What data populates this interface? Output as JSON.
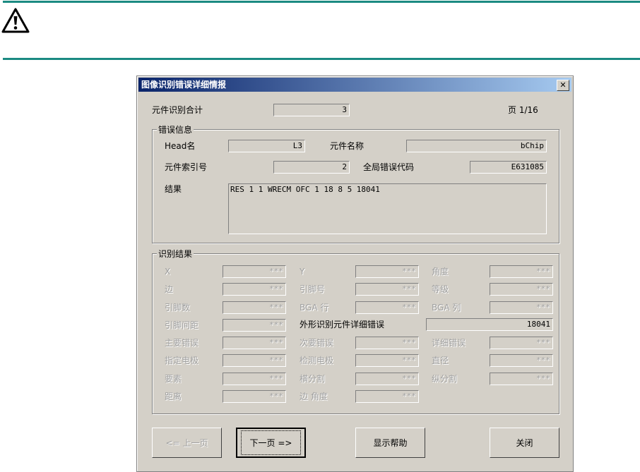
{
  "dialog": {
    "title": "图像识别错误详细情报",
    "close_x": "✕"
  },
  "summary": {
    "count_label": "元件识别合计",
    "count_value": "3",
    "page_label": "页 1/16"
  },
  "error_info": {
    "title": "错误信息",
    "head_label": "Head名",
    "head_value": "L3",
    "part_name_label": "元件名称",
    "part_name_value": "bChip",
    "index_label": "元件索引号",
    "index_value": "2",
    "global_code_label": "全局错误代码",
    "global_code_value": "E631085",
    "result_label": "结果",
    "result_value": "RES 1 1 WRECM OFC 1 18 8 5 18041"
  },
  "recognition": {
    "title": "识别结果",
    "rows": [
      [
        {
          "label": "X",
          "value": "***"
        },
        {
          "label": "Y",
          "value": "***"
        },
        {
          "label": "角度",
          "value": "***"
        }
      ],
      [
        {
          "label": "边",
          "value": "***"
        },
        {
          "label": "引脚号",
          "value": "***"
        },
        {
          "label": "等级",
          "value": "***"
        }
      ],
      [
        {
          "label": "引脚数",
          "value": "***"
        },
        {
          "label": "BGA 行",
          "value": "***"
        },
        {
          "label": "BGA 列",
          "value": "***"
        }
      ],
      [
        {
          "label": "引脚间距",
          "value": "***"
        }
      ],
      [
        {
          "label": "主要错误",
          "value": "***"
        },
        {
          "label": "次要错误",
          "value": "***"
        },
        {
          "label": "详细错误",
          "value": "***"
        }
      ],
      [
        {
          "label": "指定电极",
          "value": "***"
        },
        {
          "label": "检测电极",
          "value": "***"
        },
        {
          "label": "直径",
          "value": "***"
        }
      ],
      [
        {
          "label": "要素",
          "value": "***"
        },
        {
          "label": "横分割",
          "value": "***"
        },
        {
          "label": "纵分割",
          "value": "***"
        }
      ],
      [
        {
          "label": "距离",
          "value": "***"
        },
        {
          "label": "边 角度",
          "value": "***"
        }
      ]
    ],
    "shape_error_label": "外形识别元件详细错误",
    "shape_error_value": "18041"
  },
  "buttons": {
    "prev": "<= 上一页",
    "next": "下一页 =>",
    "help": "显示帮助",
    "close": "关闭"
  }
}
